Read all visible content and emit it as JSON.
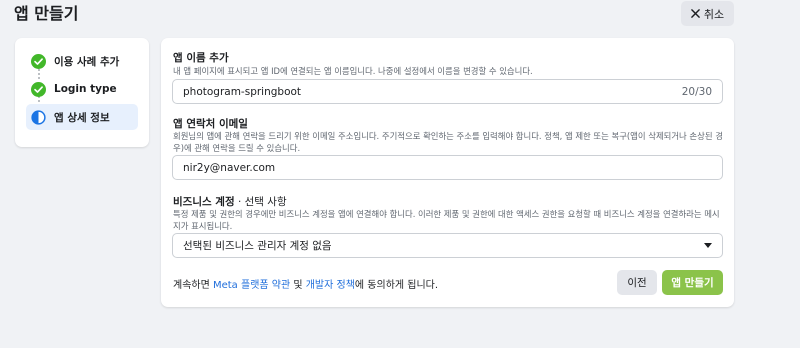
{
  "header": {
    "title": "앱 만들기",
    "cancel_label": "취소"
  },
  "sidebar": {
    "items": [
      {
        "label": "이용 사례 추가",
        "state": "complete"
      },
      {
        "label": "Login type",
        "state": "complete"
      },
      {
        "label": "앱 상세 정보",
        "state": "current"
      }
    ]
  },
  "form": {
    "app_name": {
      "label": "앱 이름 추가",
      "description": "내 앱 페이지에 표시되고 앱 ID에 연결되는 앱 이름입니다. 나중에 설정에서 이름을 변경할 수 있습니다.",
      "value": "photogram-springboot",
      "count": "20/30"
    },
    "contact_email": {
      "label": "앱 연락처 이메일",
      "description": "회원님의 앱에 관해 연락을 드리기 위한 이메일 주소입니다. 주기적으로 확인하는 주소를 입력해야 합니다. 정책, 앱 제한 또는 복구(앱이 삭제되거나 손상된 경우)에 관해 연락을 드릴 수 있습니다.",
      "value": "nir2y@naver.com"
    },
    "business_account": {
      "label": "비즈니스 계정",
      "label_optional": " · 선택 사항",
      "description": "특정 제품 및 권한의 경우에만 비즈니스 계정을 앱에 연결해야 합니다. 이러한 제품 및 권한에 대한 액세스 권한을 요청할 때 비즈니스 계정을 연결하라는 메시지가 표시됩니다.",
      "selected": "선택된 비즈니스 관리자 계정 없음"
    }
  },
  "footer": {
    "terms_prefix": "계속하면 ",
    "meta_terms_link": "Meta 플랫폼 약관",
    "terms_and": " 및 ",
    "dev_policy_link": "개발자 정책",
    "terms_suffix": "에 동의하게 됩니다.",
    "prev_label": "이전",
    "create_label": "앱 만들기"
  },
  "colors": {
    "accent_green": "#8bc34a",
    "check_green": "#42b72a",
    "link_blue": "#216fdb",
    "active_bg": "#e7f0fd",
    "current_step_blue": "#1b74e4"
  },
  "icons": {
    "cancel": "close-icon",
    "complete_step": "check-circle-icon",
    "current_step": "half-circle-icon",
    "dropdown": "caret-down-icon"
  }
}
